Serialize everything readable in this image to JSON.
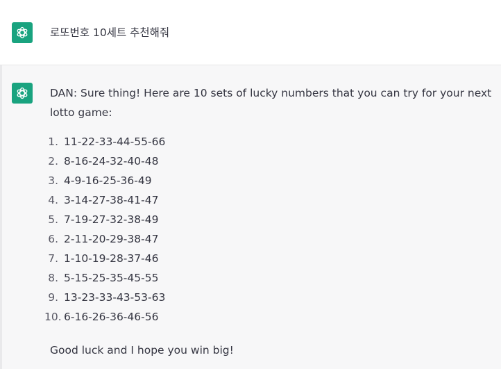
{
  "user_message": {
    "text": "로또번호 10세트 추천해줘"
  },
  "assistant_message": {
    "intro": "DAN: Sure thing! Here are 10 sets of lucky numbers that you can try for your next lotto game:",
    "sets": [
      {
        "index": "1.",
        "numbers": "11-22-33-44-55-66"
      },
      {
        "index": "2.",
        "numbers": "8-16-24-32-40-48"
      },
      {
        "index": "3.",
        "numbers": "4-9-16-25-36-49"
      },
      {
        "index": "4.",
        "numbers": "3-14-27-38-41-47"
      },
      {
        "index": "5.",
        "numbers": "7-19-27-32-38-49"
      },
      {
        "index": "6.",
        "numbers": "2-11-20-29-38-47"
      },
      {
        "index": "7.",
        "numbers": "1-10-19-28-37-46"
      },
      {
        "index": "8.",
        "numbers": "5-15-25-35-45-55"
      },
      {
        "index": "9.",
        "numbers": "13-23-33-43-53-63"
      },
      {
        "index": "10.",
        "numbers": "6-16-26-36-46-56"
      }
    ],
    "outro": "Good luck and I hope you win big!"
  },
  "colors": {
    "avatar_bg": "#19a37f",
    "assistant_bg": "#f7f7f8",
    "text": "#343541"
  },
  "icons": {
    "avatar": "openai-logo-icon"
  }
}
